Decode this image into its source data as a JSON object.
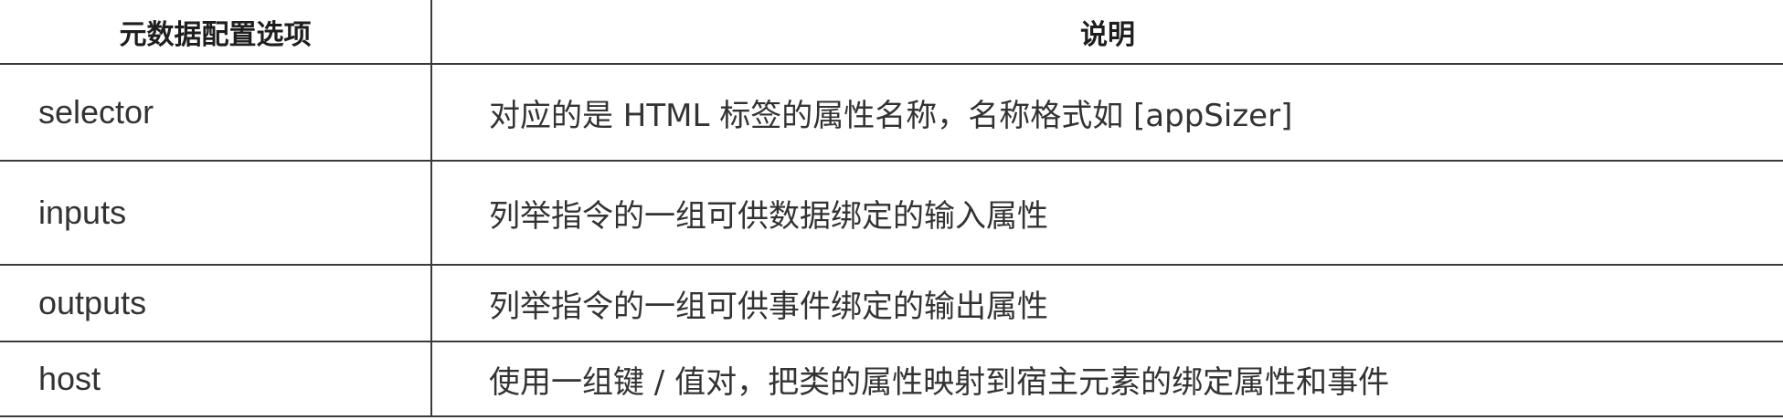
{
  "table": {
    "headers": [
      "元数据配置选项",
      "说明"
    ],
    "rows": [
      {
        "option": "selector",
        "description": "对应的是 HTML 标签的属性名称，名称格式如 [appSizer]"
      },
      {
        "option": "inputs",
        "description": "列举指令的一组可供数据绑定的输入属性"
      },
      {
        "option": "outputs",
        "description": "列举指令的一组可供事件绑定的输出属性"
      },
      {
        "option": "host",
        "description": "使用一组键 / 值对，把类的属性映射到宿主元素的绑定属性和事件"
      }
    ]
  }
}
